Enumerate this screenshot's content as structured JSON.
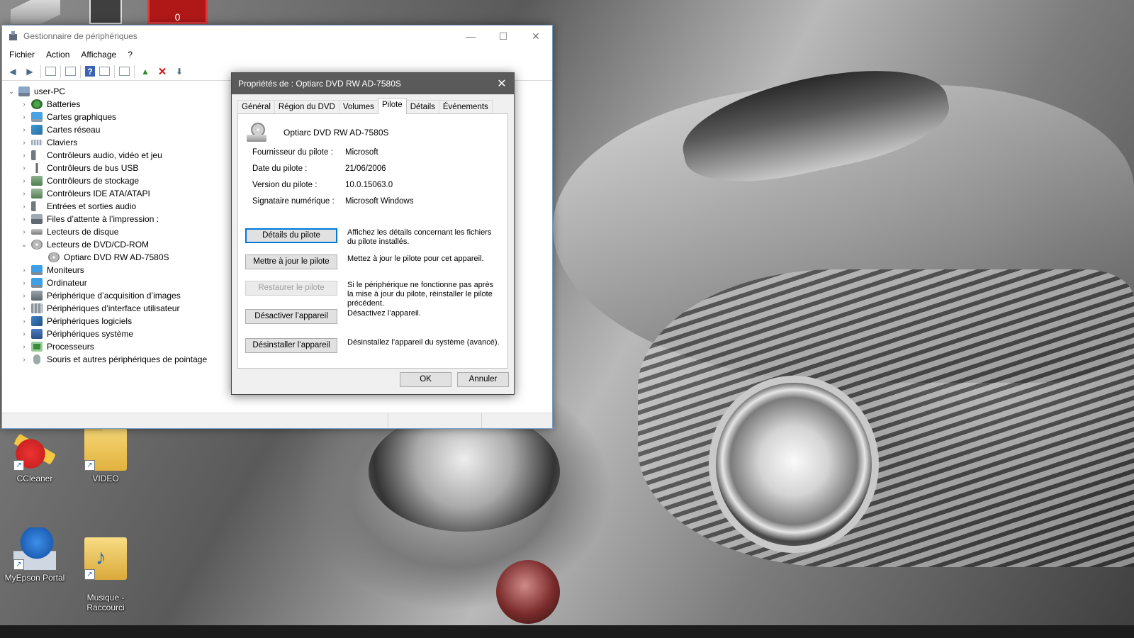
{
  "desktop": {
    "top_icon_c_text": "0",
    "icons": [
      {
        "label": "CCleaner"
      },
      {
        "label": "VIDEO"
      },
      {
        "label": "MyEpson Portal"
      },
      {
        "label": "Musique -\nRaccourci"
      }
    ],
    "shortcut_arrow": "↗"
  },
  "device_manager": {
    "title": "Gestionnaire de périphériques",
    "window_controls": {
      "minimize": "—",
      "maximize": "☐",
      "close": "✕"
    },
    "menu": [
      "Fichier",
      "Action",
      "Affichage",
      "?"
    ],
    "toolbar": {
      "back": "◀",
      "forward": "▶",
      "scan": "⬇",
      "remove": "✕",
      "enable": "▲",
      "help": "?"
    },
    "tree": {
      "root": "user-PC",
      "items": [
        {
          "label": "Batteries",
          "icon": "battery-icon",
          "expanded": false
        },
        {
          "label": "Cartes graphiques",
          "icon": "display-adapter-icon",
          "expanded": false
        },
        {
          "label": "Cartes réseau",
          "icon": "network-adapter-icon",
          "expanded": false
        },
        {
          "label": "Claviers",
          "icon": "keyboard-icon",
          "expanded": false
        },
        {
          "label": "Contrôleurs audio, vidéo et jeu",
          "icon": "audio-icon",
          "expanded": false
        },
        {
          "label": "Contrôleurs de bus USB",
          "icon": "usb-icon",
          "expanded": false
        },
        {
          "label": "Contrôleurs de stockage",
          "icon": "storage-controller-icon",
          "expanded": false
        },
        {
          "label": "Contrôleurs IDE ATA/ATAPI",
          "icon": "ide-icon",
          "expanded": false
        },
        {
          "label": "Entrées et sorties audio",
          "icon": "audio-io-icon",
          "expanded": false
        },
        {
          "label": "Files d’attente à l’impression :",
          "icon": "printer-queue-icon",
          "expanded": false
        },
        {
          "label": "Lecteurs de disque",
          "icon": "disk-drive-icon",
          "expanded": false
        },
        {
          "label": "Lecteurs de DVD/CD-ROM",
          "icon": "dvd-drive-icon",
          "expanded": true
        },
        {
          "label": "Optiarc DVD RW AD-7580S",
          "icon": "dvd-device-icon",
          "child": true
        },
        {
          "label": "Moniteurs",
          "icon": "monitor-icon",
          "expanded": false
        },
        {
          "label": "Ordinateur",
          "icon": "computer-icon",
          "expanded": false
        },
        {
          "label": "Périphérique d’acquisition d’images",
          "icon": "imaging-device-icon",
          "expanded": false
        },
        {
          "label": "Périphériques d’interface utilisateur",
          "icon": "hid-icon",
          "expanded": false
        },
        {
          "label": "Périphériques logiciels",
          "icon": "software-device-icon",
          "expanded": false
        },
        {
          "label": "Périphériques système",
          "icon": "system-device-icon",
          "expanded": false
        },
        {
          "label": "Processeurs",
          "icon": "processor-icon",
          "expanded": false
        },
        {
          "label": "Souris et autres périphériques de pointage",
          "icon": "mouse-icon",
          "expanded": false
        }
      ]
    }
  },
  "properties_dialog": {
    "title": "Propriétés de : Optiarc DVD RW AD-7580S",
    "close": "✕",
    "tabs": [
      "Général",
      "Région du DVD",
      "Volumes",
      "Pilote",
      "Détails",
      "Événements"
    ],
    "active_tab": "Pilote",
    "device_name": "Optiarc DVD RW AD-7580S",
    "properties": [
      {
        "key": "Fournisseur du pilote :",
        "value": "Microsoft"
      },
      {
        "key": "Date du pilote :",
        "value": "21/06/2006"
      },
      {
        "key": "Version du pilote :",
        "value": "10.0.15063.0"
      },
      {
        "key": "Signataire numérique :",
        "value": "Microsoft Windows"
      }
    ],
    "actions": [
      {
        "button": "Détails du pilote",
        "description": "Affichez les détails concernant les fichiers du pilote installés.",
        "enabled": true,
        "focused": true
      },
      {
        "button": "Mettre à jour le pilote",
        "description": "Mettez à jour le pilote pour cet appareil.",
        "enabled": true
      },
      {
        "button": "Restaurer le pilote",
        "description": "Si le périphérique ne fonctionne pas après la mise à jour du pilote, réinstaller le pilote précédent.",
        "enabled": false
      },
      {
        "button": "Désactiver l’appareil",
        "description": "Désactivez l’appareil.",
        "enabled": true
      },
      {
        "button": "Désinstaller l’appareil",
        "description": "Désinstallez l’appareil du système (avancé).",
        "enabled": true
      }
    ],
    "ok": "OK",
    "cancel": "Annuler"
  }
}
